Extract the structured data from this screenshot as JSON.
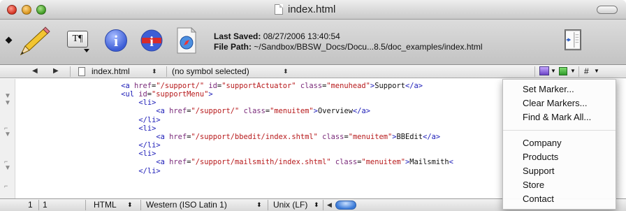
{
  "window": {
    "title": "index.html"
  },
  "toolbar": {
    "last_saved_label": "Last Saved:",
    "last_saved_value": "08/27/2006 13:40:54",
    "file_path_label": "File Path:",
    "file_path_value": "~/Sandbox/BBSW_Docs/Docu...8.5/doc_examples/index.html",
    "text_options_glyph": "T¶"
  },
  "navbar": {
    "file_name": "index.html",
    "symbol": "(no symbol selected)",
    "pound": "#"
  },
  "editor": {
    "lines": [
      {
        "indent": 12,
        "parts": [
          [
            "t",
            "<a "
          ],
          [
            "a",
            "href"
          ],
          [
            "x",
            "="
          ],
          [
            "v",
            "\"/support/\""
          ],
          [
            "x",
            " "
          ],
          [
            "a",
            "id"
          ],
          [
            "x",
            "="
          ],
          [
            "v",
            "\"supportActuator\""
          ],
          [
            "x",
            " "
          ],
          [
            "a",
            "class"
          ],
          [
            "x",
            "="
          ],
          [
            "v",
            "\"menuhead\""
          ],
          [
            "t",
            ">"
          ],
          [
            "x",
            "Support"
          ],
          [
            "t",
            "</a>"
          ]
        ]
      },
      {
        "indent": 12,
        "parts": [
          [
            "t",
            "<ul "
          ],
          [
            "a",
            "id"
          ],
          [
            "x",
            "="
          ],
          [
            "v",
            "\"supportMenu\""
          ],
          [
            "t",
            ">"
          ]
        ]
      },
      {
        "indent": 16,
        "parts": [
          [
            "t",
            "<li>"
          ]
        ]
      },
      {
        "indent": 20,
        "parts": [
          [
            "t",
            "<a "
          ],
          [
            "a",
            "href"
          ],
          [
            "x",
            "="
          ],
          [
            "v",
            "\"/support/\""
          ],
          [
            "x",
            " "
          ],
          [
            "a",
            "class"
          ],
          [
            "x",
            "="
          ],
          [
            "v",
            "\"menuitem\""
          ],
          [
            "t",
            ">"
          ],
          [
            "x",
            "Overview"
          ],
          [
            "t",
            "</a>"
          ]
        ]
      },
      {
        "indent": 16,
        "parts": [
          [
            "t",
            "</li>"
          ]
        ]
      },
      {
        "indent": 16,
        "parts": [
          [
            "t",
            "<li>"
          ]
        ]
      },
      {
        "indent": 20,
        "parts": [
          [
            "t",
            "<a "
          ],
          [
            "a",
            "href"
          ],
          [
            "x",
            "="
          ],
          [
            "v",
            "\"/support/bbedit/index.shtml\""
          ],
          [
            "x",
            " "
          ],
          [
            "a",
            "class"
          ],
          [
            "x",
            "="
          ],
          [
            "v",
            "\"menuitem\""
          ],
          [
            "t",
            ">"
          ],
          [
            "x",
            "BBEdit"
          ],
          [
            "t",
            "</a>"
          ]
        ]
      },
      {
        "indent": 16,
        "parts": [
          [
            "t",
            "</li>"
          ]
        ]
      },
      {
        "indent": 16,
        "parts": [
          [
            "t",
            "<li>"
          ]
        ]
      },
      {
        "indent": 20,
        "parts": [
          [
            "t",
            "<a "
          ],
          [
            "a",
            "href"
          ],
          [
            "x",
            "="
          ],
          [
            "v",
            "\"/support/mailsmith/index.shtml\""
          ],
          [
            "x",
            " "
          ],
          [
            "a",
            "class"
          ],
          [
            "x",
            "="
          ],
          [
            "v",
            "\"menuitem\""
          ],
          [
            "t",
            ">"
          ],
          [
            "x",
            "Mailsmith"
          ],
          [
            "t",
            "<"
          ]
        ]
      },
      {
        "indent": 16,
        "parts": [
          [
            "t",
            "</li>"
          ]
        ]
      }
    ]
  },
  "statusbar": {
    "line": "1",
    "column": "1",
    "language": "HTML",
    "encoding": "Western (ISO Latin 1)",
    "line_endings": "Unix (LF)"
  },
  "marker_menu": {
    "actions": [
      "Set Marker...",
      "Clear Markers...",
      "Find & Mark All..."
    ],
    "markers": [
      "Company",
      "Products",
      "Support",
      "Store",
      "Contact"
    ]
  }
}
